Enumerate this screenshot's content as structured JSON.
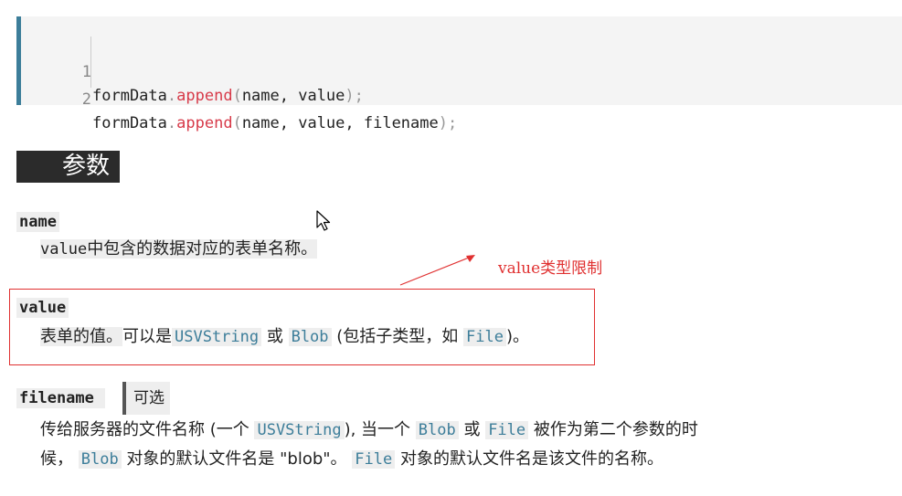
{
  "code": {
    "lines": [
      {
        "num": "1",
        "obj": "formData",
        "dot": ".",
        "method": "append",
        "open": "(",
        "args": "name, value",
        "close": ");"
      },
      {
        "num": "2",
        "obj": "formData",
        "dot": ".",
        "method": "append",
        "open": "(",
        "args": "name, value, filename",
        "close": ");"
      }
    ]
  },
  "section": {
    "title": "参数"
  },
  "params": {
    "name": {
      "term": "name",
      "desc_code": "value",
      "desc_text": "中包含的数据对应的表单名称。"
    },
    "value": {
      "term": "value",
      "desc_prefix": "表单的值。",
      "desc_mid1": "可以是",
      "code1": "USVString",
      "or": " 或 ",
      "code2": "Blob",
      "desc_mid2": " (包括子类型，如 ",
      "code3": "File",
      "desc_end": ")。"
    },
    "filename": {
      "term": "filename",
      "optional": "可选",
      "line1_a": "传给服务器的文件名称 (一个 ",
      "code1": "USVString",
      "line1_b": "), 当一个 ",
      "code2": "Blob",
      "line1_c": " 或 ",
      "code3": "File",
      "line1_d": " 被作为第二个参数的时",
      "line2_a": "候， ",
      "code4": "Blob",
      "line2_b": " 对象的默认文件名是 \"blob\"。 ",
      "code5": "File",
      "line2_c": " 对象的默认文件名是该文件的名称。"
    }
  },
  "annotation": {
    "label": "value类型限制",
    "color": "#e03030"
  },
  "colors": {
    "accent": "#3d7e9a",
    "keyword": "#d73a49"
  }
}
